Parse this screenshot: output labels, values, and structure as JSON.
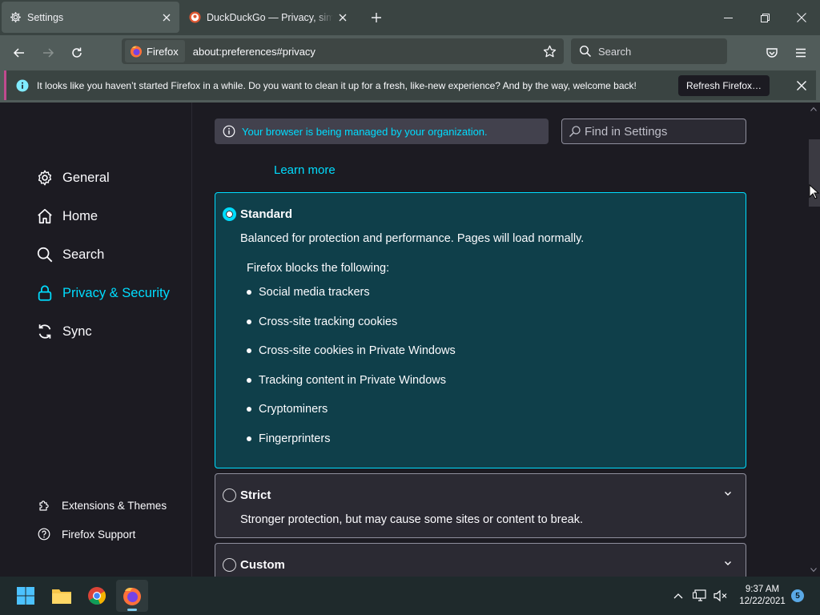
{
  "tabs": [
    {
      "label": "Settings",
      "icon": "gear-icon"
    },
    {
      "label": "DuckDuckGo — Privacy, simplif",
      "icon": "duckduckgo-icon"
    }
  ],
  "navbar": {
    "identity_label": "Firefox",
    "url": "about:preferences#privacy",
    "search_placeholder": "Search"
  },
  "notification": {
    "text": "It looks like you haven’t started Firefox in a while. Do you want to clean it up for a fresh, like-new experience? And by the way, welcome back!",
    "button": "Refresh Firefox…"
  },
  "sidebar": {
    "items": [
      {
        "label": "General",
        "icon": "gear-icon"
      },
      {
        "label": "Home",
        "icon": "home-icon"
      },
      {
        "label": "Search",
        "icon": "search-icon"
      },
      {
        "label": "Privacy & Security",
        "icon": "lock-icon",
        "selected": true
      },
      {
        "label": "Sync",
        "icon": "sync-icon"
      }
    ],
    "footer": [
      {
        "label": "Extensions & Themes",
        "icon": "puzzle-icon"
      },
      {
        "label": "Firefox Support",
        "icon": "help-icon"
      }
    ]
  },
  "main": {
    "managed_notice": "Your browser is being managed by your organization.",
    "find_placeholder": "Find in Settings",
    "learn_more": "Learn more",
    "standard": {
      "title": "Standard",
      "description": "Balanced for protection and performance. Pages will load normally.",
      "blocks_title": "Firefox blocks the following:",
      "blocks": [
        "Social media trackers",
        "Cross-site tracking cookies",
        "Cross-site cookies in Private Windows",
        "Tracking content in Private Windows",
        "Cryptominers",
        "Fingerprinters"
      ]
    },
    "strict": {
      "title": "Strict",
      "description": "Stronger protection, but may cause some sites or content to break."
    },
    "custom": {
      "title": "Custom"
    }
  },
  "taskbar": {
    "time": "9:37 AM",
    "date": "12/22/2021",
    "notification_count": "5"
  },
  "colors": {
    "accent": "#00ddff",
    "chrome": "#515c5a",
    "tabstrip": "#3a4442",
    "content_bg": "#1c1b22",
    "selected_card": "#0f3f4a",
    "notice_border": "#c04a8e"
  }
}
